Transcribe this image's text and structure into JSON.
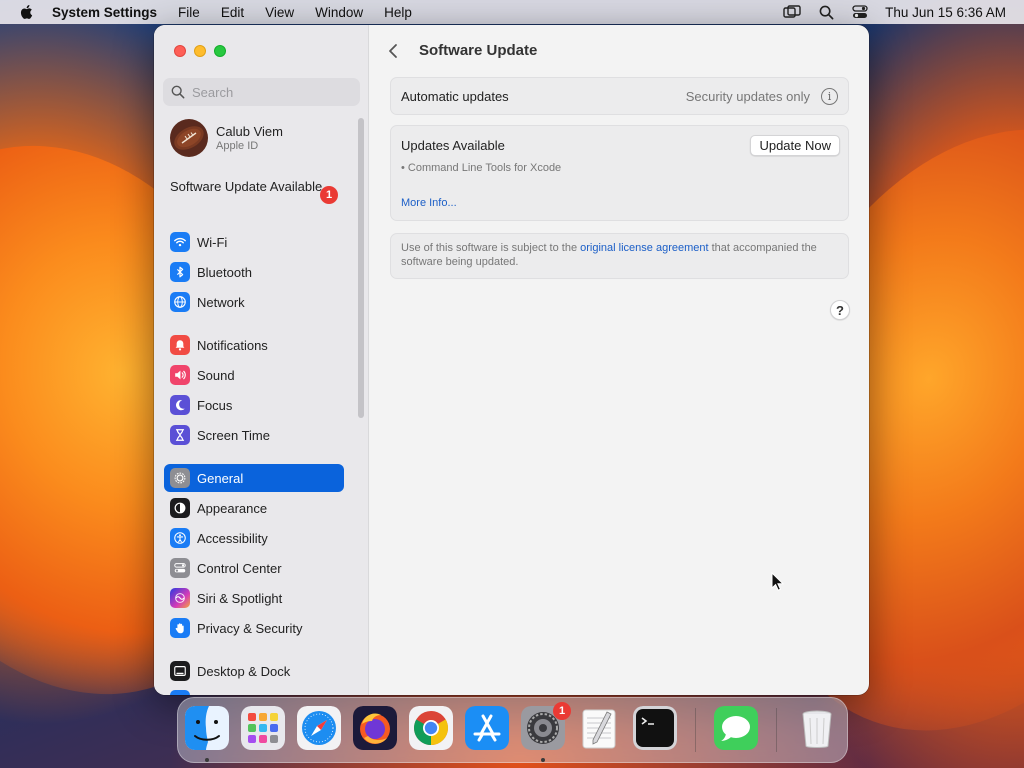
{
  "menubar": {
    "app_name": "System Settings",
    "menus": [
      "File",
      "Edit",
      "View",
      "Window",
      "Help"
    ],
    "clock": "Thu Jun 15  6:36 AM"
  },
  "sidebar": {
    "search_placeholder": "Search",
    "profile": {
      "name": "Calub Viem",
      "subtitle": "Apple ID"
    },
    "update_notice": {
      "label": "Software Update Available",
      "badge": "1"
    },
    "groups": [
      [
        {
          "label": "Wi-Fi",
          "icon": "wifi-icon",
          "color": "#1a7cf5"
        },
        {
          "label": "Bluetooth",
          "icon": "bluetooth-icon",
          "color": "#1a7cf5"
        },
        {
          "label": "Network",
          "icon": "globe-icon",
          "color": "#1a7cf5"
        }
      ],
      [
        {
          "label": "Notifications",
          "icon": "bell-icon",
          "color": "#f14b44"
        },
        {
          "label": "Sound",
          "icon": "speaker-icon",
          "color": "#f0446b"
        },
        {
          "label": "Focus",
          "icon": "moon-icon",
          "color": "#5b50d6"
        },
        {
          "label": "Screen Time",
          "icon": "hourglass-icon",
          "color": "#5b50d6"
        }
      ],
      [
        {
          "label": "General",
          "icon": "gear-icon",
          "color": "#8e8e93",
          "active": true
        },
        {
          "label": "Appearance",
          "icon": "appearance-icon",
          "color": "#1c1c1e"
        },
        {
          "label": "Accessibility",
          "icon": "accessibility-icon",
          "color": "#1a7cf5"
        },
        {
          "label": "Control Center",
          "icon": "toggles-icon",
          "color": "#8e8e93"
        },
        {
          "label": "Siri & Spotlight",
          "icon": "siri-icon",
          "color": "#b04ad6"
        },
        {
          "label": "Privacy & Security",
          "icon": "hand-icon",
          "color": "#1a7cf5"
        }
      ],
      [
        {
          "label": "Desktop & Dock",
          "icon": "dock-icon",
          "color": "#1c1c1e"
        }
      ]
    ]
  },
  "content": {
    "title": "Software Update",
    "automatic": {
      "label": "Automatic updates",
      "value": "Security updates only"
    },
    "updates": {
      "label": "Updates Available",
      "button": "Update Now",
      "item": "• Command Line Tools for Xcode",
      "more": "More Info..."
    },
    "license": {
      "text_before": "Use of this software is subject to the ",
      "link": "original license agreement",
      "text_after": " that accompanied the software being updated."
    },
    "help": "?"
  },
  "dock": {
    "apps": [
      "Finder",
      "Launchpad",
      "Safari",
      "Firefox",
      "Chrome",
      "App Store",
      "System Settings",
      "TextEdit",
      "Terminal",
      "Messages",
      "Trash"
    ],
    "settings_badge": "1"
  }
}
